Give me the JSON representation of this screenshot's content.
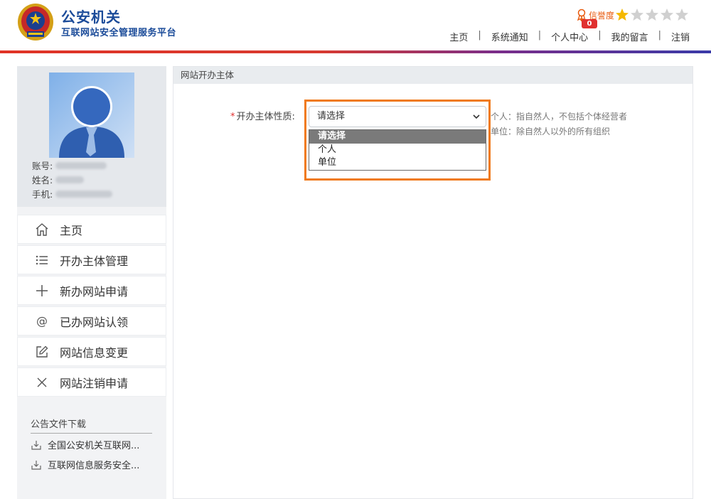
{
  "header": {
    "title": "公安机关",
    "subtitle": "互联网站安全管理服务平台",
    "rating_label": "信誉度",
    "rating_stars": 1,
    "rating_max": 5,
    "message_count": "0",
    "nav": [
      "主页",
      "系统通知",
      "个人中心",
      "我的留言",
      "注销"
    ]
  },
  "profile": {
    "account_label": "账号:",
    "name_label": "姓名:",
    "phone_label": "手机:"
  },
  "sidebar": {
    "items": [
      {
        "label": "主页",
        "icon": "home-icon"
      },
      {
        "label": "开办主体管理",
        "icon": "list-icon"
      },
      {
        "label": "新办网站申请",
        "icon": "plus-icon"
      },
      {
        "label": "已办网站认领",
        "icon": "at-icon"
      },
      {
        "label": "网站信息变更",
        "icon": "edit-icon"
      },
      {
        "label": "网站注销申请",
        "icon": "close-icon"
      }
    ],
    "downloads_title": "公告文件下载",
    "downloads": [
      "全国公安机关互联网...",
      "互联网信息服务安全..."
    ]
  },
  "main": {
    "panel_title": "网站开办主体",
    "field_label": "开办主体性质:",
    "required_mark": "*",
    "select_value": "请选择",
    "options": [
      "请选择",
      "个人",
      "单位"
    ],
    "hint_personal": "个人：指自然人，不包括个体经营者",
    "hint_unit": "单位：除自然人以外的所有组织"
  },
  "colors": {
    "brand_blue": "#1b4b99",
    "accent_orange": "#f07a1a",
    "required_red": "#e03030",
    "star_gold": "#f5b800"
  }
}
